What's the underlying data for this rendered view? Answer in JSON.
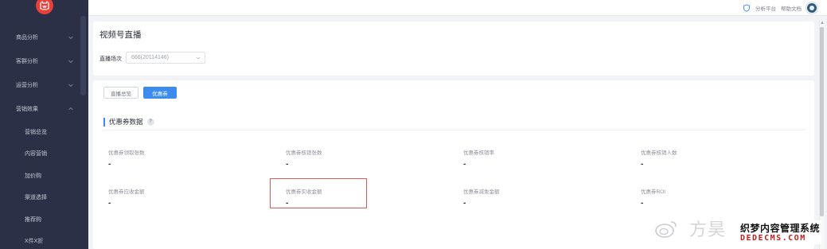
{
  "sidebar": {
    "logo_icon": "tmall-cat-logo",
    "menu": [
      {
        "label": "商品分析"
      },
      {
        "label": "客群分析"
      },
      {
        "label": "运营分析"
      },
      {
        "label": "营销效果"
      }
    ],
    "submenu": [
      {
        "label": "营销总览"
      },
      {
        "label": "内容营销"
      },
      {
        "label": "加价购"
      },
      {
        "label": "渠道选择"
      },
      {
        "label": "推荐购"
      },
      {
        "label": "X件X折"
      }
    ]
  },
  "header": {
    "platform_link": "分析平台",
    "docs_link": "帮助文档"
  },
  "page": {
    "title": "视频号直播",
    "field_label": "直播场次",
    "session_value": "666(20114146)"
  },
  "tabs": {
    "overview": "直播总览",
    "coupon": "优惠券"
  },
  "section": {
    "title": "优惠券数据",
    "help": "?"
  },
  "metrics": [
    {
      "label": "优惠券领取张数",
      "value": "-"
    },
    {
      "label": "优惠券核销张数",
      "value": "-"
    },
    {
      "label": "优惠券核销率",
      "value": "-"
    },
    {
      "label": "优惠券核销人数",
      "value": "-"
    },
    {
      "label": "优惠券应收金额",
      "value": "-"
    },
    {
      "label": "优惠券实收金额",
      "value": "-"
    },
    {
      "label": "优惠券减免金额",
      "value": "-"
    },
    {
      "label": "优惠券ROI",
      "value": "-"
    }
  ],
  "watermark": {
    "author": "方昊",
    "brand": "织梦内容管理系统",
    "domain": "DEDECMS.COM"
  },
  "colors": {
    "sidebar_bg": "#2b3046",
    "accent": "#3c8cf0",
    "highlight": "#e05a58"
  }
}
